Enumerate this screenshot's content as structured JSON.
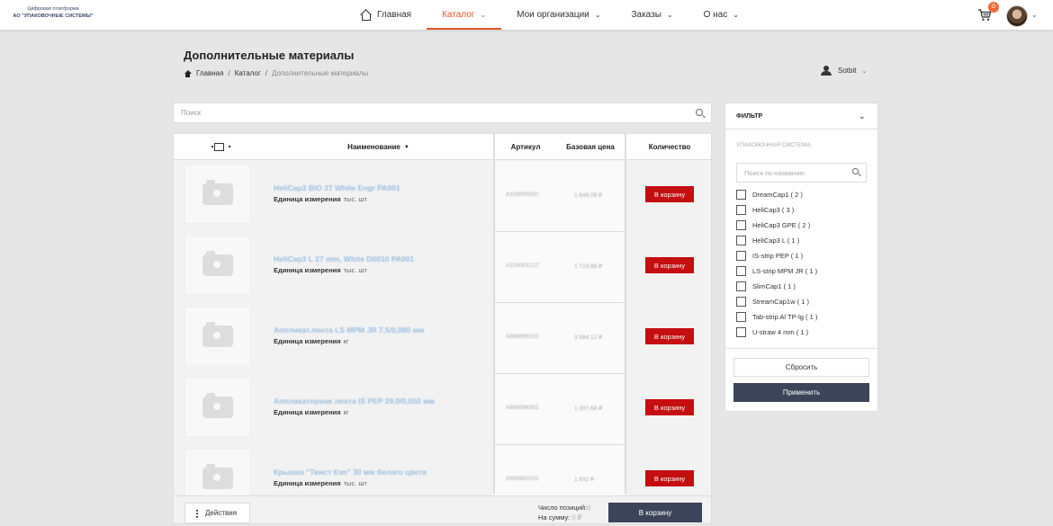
{
  "header": {
    "logo_line1": "Цифровая платформа",
    "logo_line2": "АО \"УПАКОВОЧНЫЕ СИСТЕМЫ\"",
    "nav": [
      {
        "label": "Главная",
        "active": false,
        "has_chevron": false,
        "icon": "home-icon"
      },
      {
        "label": "Каталог",
        "active": true,
        "has_chevron": true
      },
      {
        "label": "Мои организации",
        "active": false,
        "has_chevron": true
      },
      {
        "label": "Заказы",
        "active": false,
        "has_chevron": true
      },
      {
        "label": "О нас",
        "active": false,
        "has_chevron": true
      }
    ],
    "cart_count": "0",
    "accent_color": "#e2562c"
  },
  "page": {
    "title": "Дополнительные материалы",
    "breadcrumb": [
      "Главная",
      "Каталог",
      "Дополнительные материалы"
    ],
    "user_name": "Sotbit"
  },
  "search": {
    "placeholder": "Поиск"
  },
  "table": {
    "columns": {
      "name": "Наименование",
      "article": "Артикул",
      "price": "Базовая цена",
      "quantity": "Количество"
    },
    "unit_label": "Единица измерения",
    "add_to_cart_label": "В корзину",
    "rows": [
      {
        "name": "HeliCap3 BIO 27 White Engr PA001",
        "unit": "тыс. шт",
        "article": "А100000257",
        "price": "1 648.08 ₽"
      },
      {
        "name": "HeliCap3 L 27 mm, White D0010 PA001",
        "unit": "тыс. шт",
        "article": "А100001217",
        "price": "1 723.68 ₽"
      },
      {
        "name": "Аппликат.лента LS MPM JR 7,5/0,080 мм",
        "unit": "кг",
        "article": "А885695101",
        "price": "3 984.12 ₽"
      },
      {
        "name": "Аппликаторная лента IS PEP 29,0/0,050 мм",
        "unit": "кг",
        "article": "А886596301",
        "price": "1 397.68 ₽"
      },
      {
        "name": "Крышка \"Твист Кэп\" 30 мм белого цвета",
        "unit": "тыс. шт",
        "article": "А895800101",
        "price": "1 932 ₽"
      }
    ],
    "footer": {
      "actions_label": "Действия",
      "positions_label": "Число позиций:",
      "positions_value": "0",
      "sum_label": "На сумму:",
      "sum_value": "0 ₽",
      "cart_button": "В корзину"
    },
    "cart_button_color": "#c40e10"
  },
  "filter": {
    "title": "ФИЛЬТР",
    "section": "УПАКОВОЧНАЯ СИСТЕМА",
    "search_placeholder": "Поиск по названию",
    "options": [
      "DreamCap1 ( 2 )",
      "HeliCap3 ( 3 )",
      "HeliCap3 GPE ( 2 )",
      "HeliCap3 L ( 1 )",
      "IS-strip PEP ( 1 )",
      "LS-strip MPM JR ( 1 )",
      "SlimCap1 ( 1 )",
      "StreamCap1w ( 1 )",
      "Tab-strip Al TP-lg ( 1 )",
      "U-straw 4 mm ( 1 )"
    ],
    "reset_label": "Сбросить",
    "apply_label": "Применить",
    "apply_color": "#3c4459"
  }
}
